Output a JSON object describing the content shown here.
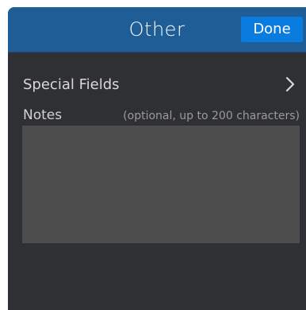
{
  "header": {
    "title": "Other",
    "done_label": "Done"
  },
  "special_fields": {
    "label": "Special Fields",
    "icon": "chevron-right-icon"
  },
  "notes": {
    "label": "Notes",
    "hint": "(optional, up to 200 characters)",
    "value": ""
  },
  "colors": {
    "header_bg": "#1f5d96",
    "done_bg": "#0a7bdf",
    "panel_bg": "#2f3033",
    "notes_bg": "#4d4d4d"
  }
}
